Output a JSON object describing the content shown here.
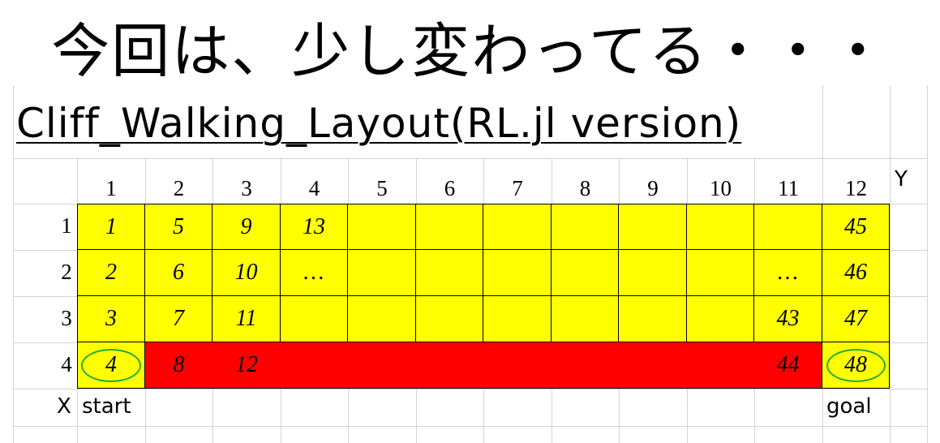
{
  "headline": "今回は、少し変わってる・・・",
  "title": "Cliff_Walking_Layout(RL.jl version)",
  "col_headers": [
    "1",
    "2",
    "3",
    "4",
    "5",
    "6",
    "7",
    "8",
    "9",
    "10",
    "11",
    "12"
  ],
  "row_headers": [
    "1",
    "2",
    "3",
    "4"
  ],
  "y_axis_label": "Y",
  "x_axis_label": "X",
  "start_label": "start",
  "goal_label": "goal",
  "grid": [
    [
      "1",
      "5",
      "9",
      "13",
      "",
      "",
      "",
      "",
      "",
      "",
      "",
      "45"
    ],
    [
      "2",
      "6",
      "10",
      "…",
      "",
      "",
      "",
      "",
      "",
      "",
      "…",
      "46"
    ],
    [
      "3",
      "7",
      "11",
      "",
      "",
      "",
      "",
      "",
      "",
      "",
      "43",
      "47"
    ],
    [
      "4",
      "8",
      "12",
      "",
      "",
      "",
      "",
      "",
      "",
      "",
      "44",
      "48"
    ]
  ],
  "cell_colors": {
    "safe": "#ffff00",
    "cliff": "#ff0000",
    "marker": "#22aa33"
  },
  "cliff_cells": [
    [
      3,
      1
    ],
    [
      3,
      2
    ],
    [
      3,
      3
    ],
    [
      3,
      4
    ],
    [
      3,
      5
    ],
    [
      3,
      6
    ],
    [
      3,
      7
    ],
    [
      3,
      8
    ],
    [
      3,
      9
    ],
    [
      3,
      10
    ]
  ],
  "circled_cells": [
    [
      3,
      0
    ],
    [
      3,
      11
    ]
  ]
}
